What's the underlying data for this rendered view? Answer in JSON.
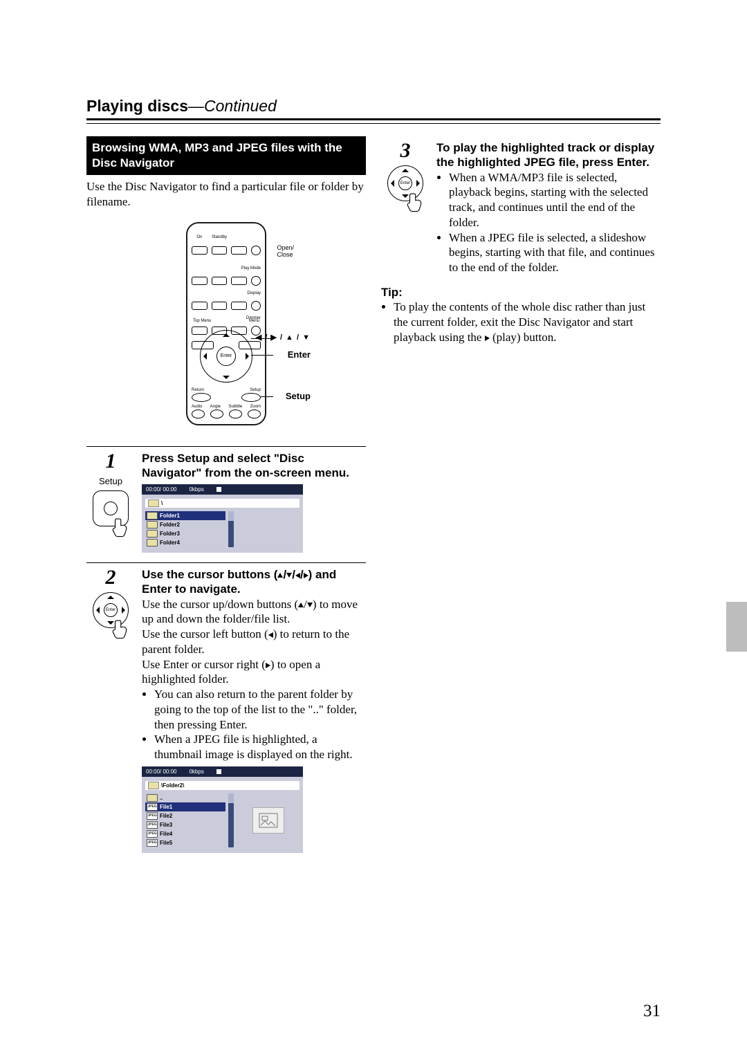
{
  "chapter": {
    "title": "Playing discs",
    "continued": "—Continued"
  },
  "section": {
    "heading": "Browsing WMA, MP3 and JPEG files with the Disc Navigator"
  },
  "intro": "Use the Disc Navigator to find a particular file or folder by filename.",
  "remote_callouts": {
    "open_close": "Open/\nClose",
    "arrows": "◀ / ▶ / ▲ / ▼",
    "enter": "Enter",
    "setup": "Setup",
    "mini": {
      "on": "On",
      "standby": "Standby",
      "playmode": "Play Mode",
      "display": "Display",
      "dimmer": "Dimmer",
      "topmenu": "Top Menu",
      "menu": "Menu",
      "return": "Return",
      "setup": "Setup",
      "audio": "Audio",
      "angle": "Angle",
      "subtitle": "Subtitle",
      "zoom": "Zoom",
      "enter": "Enter"
    }
  },
  "steps": [
    {
      "num": "1",
      "icon_label": "Setup",
      "heading": "Press Setup and select \"Disc Navigator\" from the on-screen menu.",
      "screen": {
        "time": "00:00/ 00:00",
        "bitrate": "0kbps",
        "path": "\\",
        "items": [
          {
            "type": "folder",
            "label": "Folder1",
            "sel": true
          },
          {
            "type": "folder",
            "label": "Folder2"
          },
          {
            "type": "folder",
            "label": "Folder3"
          },
          {
            "type": "folder",
            "label": "Folder4"
          }
        ]
      }
    },
    {
      "num": "2",
      "heading_pre": "Use the cursor buttons (",
      "heading_post": ") and Enter to navigate.",
      "para1_pre": "Use the cursor up/down buttons (",
      "para1_post": ") to move up and down the folder/file list.",
      "para2_pre": "Use the cursor left button (",
      "para2_post": ") to return to the parent folder.",
      "para3_pre": "Use Enter or cursor right (",
      "para3_post": ") to open a highlighted folder.",
      "bullets": [
        "You can also return to the parent folder by going to the top of the list to the \"..\" folder, then pressing Enter.",
        "When a JPEG file is highlighted, a thumbnail image is displayed on the right."
      ],
      "screen": {
        "time": "00:00/ 00:00",
        "bitrate": "0kbps",
        "path": "\\Folder2\\",
        "items": [
          {
            "type": "folder",
            "label": ".."
          },
          {
            "type": "jpeg",
            "label": "File1",
            "sel": true
          },
          {
            "type": "jpeg",
            "label": "File2"
          },
          {
            "type": "jpeg",
            "label": "File3"
          },
          {
            "type": "jpeg",
            "label": "File4"
          },
          {
            "type": "jpeg",
            "label": "File5"
          }
        ],
        "preview": true
      }
    },
    {
      "num": "3",
      "heading": "To play the highlighted track or display the highlighted JPEG file, press Enter.",
      "bullets": [
        "When a WMA/MP3 file is selected, playback begins, starting with the selected track, and continues until the end of the folder.",
        "When a JPEG file is selected, a slideshow begins, starting with that file, and continues to the end of the folder."
      ]
    }
  ],
  "tip": {
    "label": "Tip:",
    "item_pre": "To play the contents of the whole disc rather than just the current folder, exit the Disc Navigator and start playback using the ",
    "item_post": " (play) button."
  },
  "page_number": "31"
}
